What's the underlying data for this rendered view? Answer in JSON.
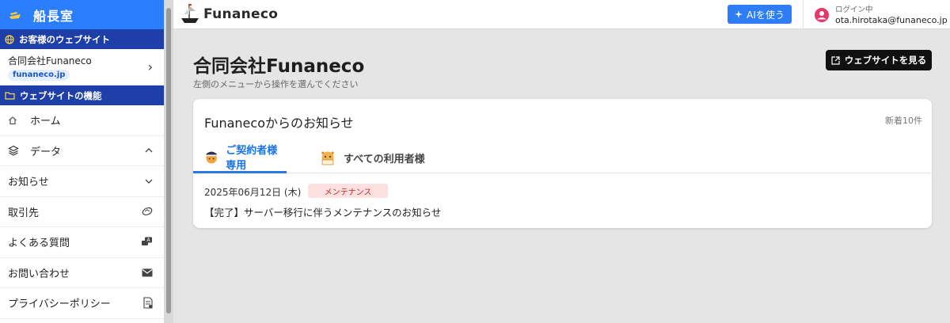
{
  "sidebar": {
    "title": "船長室",
    "section_site": "お客様のウェブサイト",
    "site_name": "合同会社Funaneco",
    "site_domain": "funaneco.jp",
    "section_features": "ウェブサイトの機能",
    "items": [
      {
        "label": "ホーム",
        "icon": "home-icon"
      },
      {
        "label": "データ",
        "icon": "layers-icon",
        "right": "chevron-up-icon"
      },
      {
        "label": "お知らせ",
        "right": "chevron-down-icon"
      },
      {
        "label": "取引先",
        "right": "handshake-icon"
      },
      {
        "label": "よくある質問",
        "right": "faq-icon"
      },
      {
        "label": "お問い合わせ",
        "right": "mail-icon"
      },
      {
        "label": "プライバシーポリシー",
        "right": "document-icon"
      }
    ]
  },
  "topbar": {
    "brand": "Funaneco",
    "ai_button": "AIを使う",
    "login_label": "ログイン中",
    "user_email": "ota.hirotaka@funaneco.jp"
  },
  "main": {
    "title": "合同会社Funaneco",
    "subtitle": "左側のメニューから操作を選んでください",
    "view_site_button": "ウェブサイトを見る",
    "news": {
      "title": "Funanecoからのお知らせ",
      "count": "新着10件",
      "tabs": [
        "ご契約者様専用",
        "すべての利用者様"
      ],
      "items": [
        {
          "date": "2025年06月12日 (木)",
          "badge": "メンテナンス",
          "title": "【完了】サーバー移行に伴うメンテナンスのお知らせ"
        }
      ]
    }
  },
  "colors": {
    "primary": "#2b7fff",
    "section": "#1f3fa8",
    "accent_tab": "#1a73e8",
    "badge_bg": "#fde0e0",
    "badge_text": "#c62828"
  }
}
